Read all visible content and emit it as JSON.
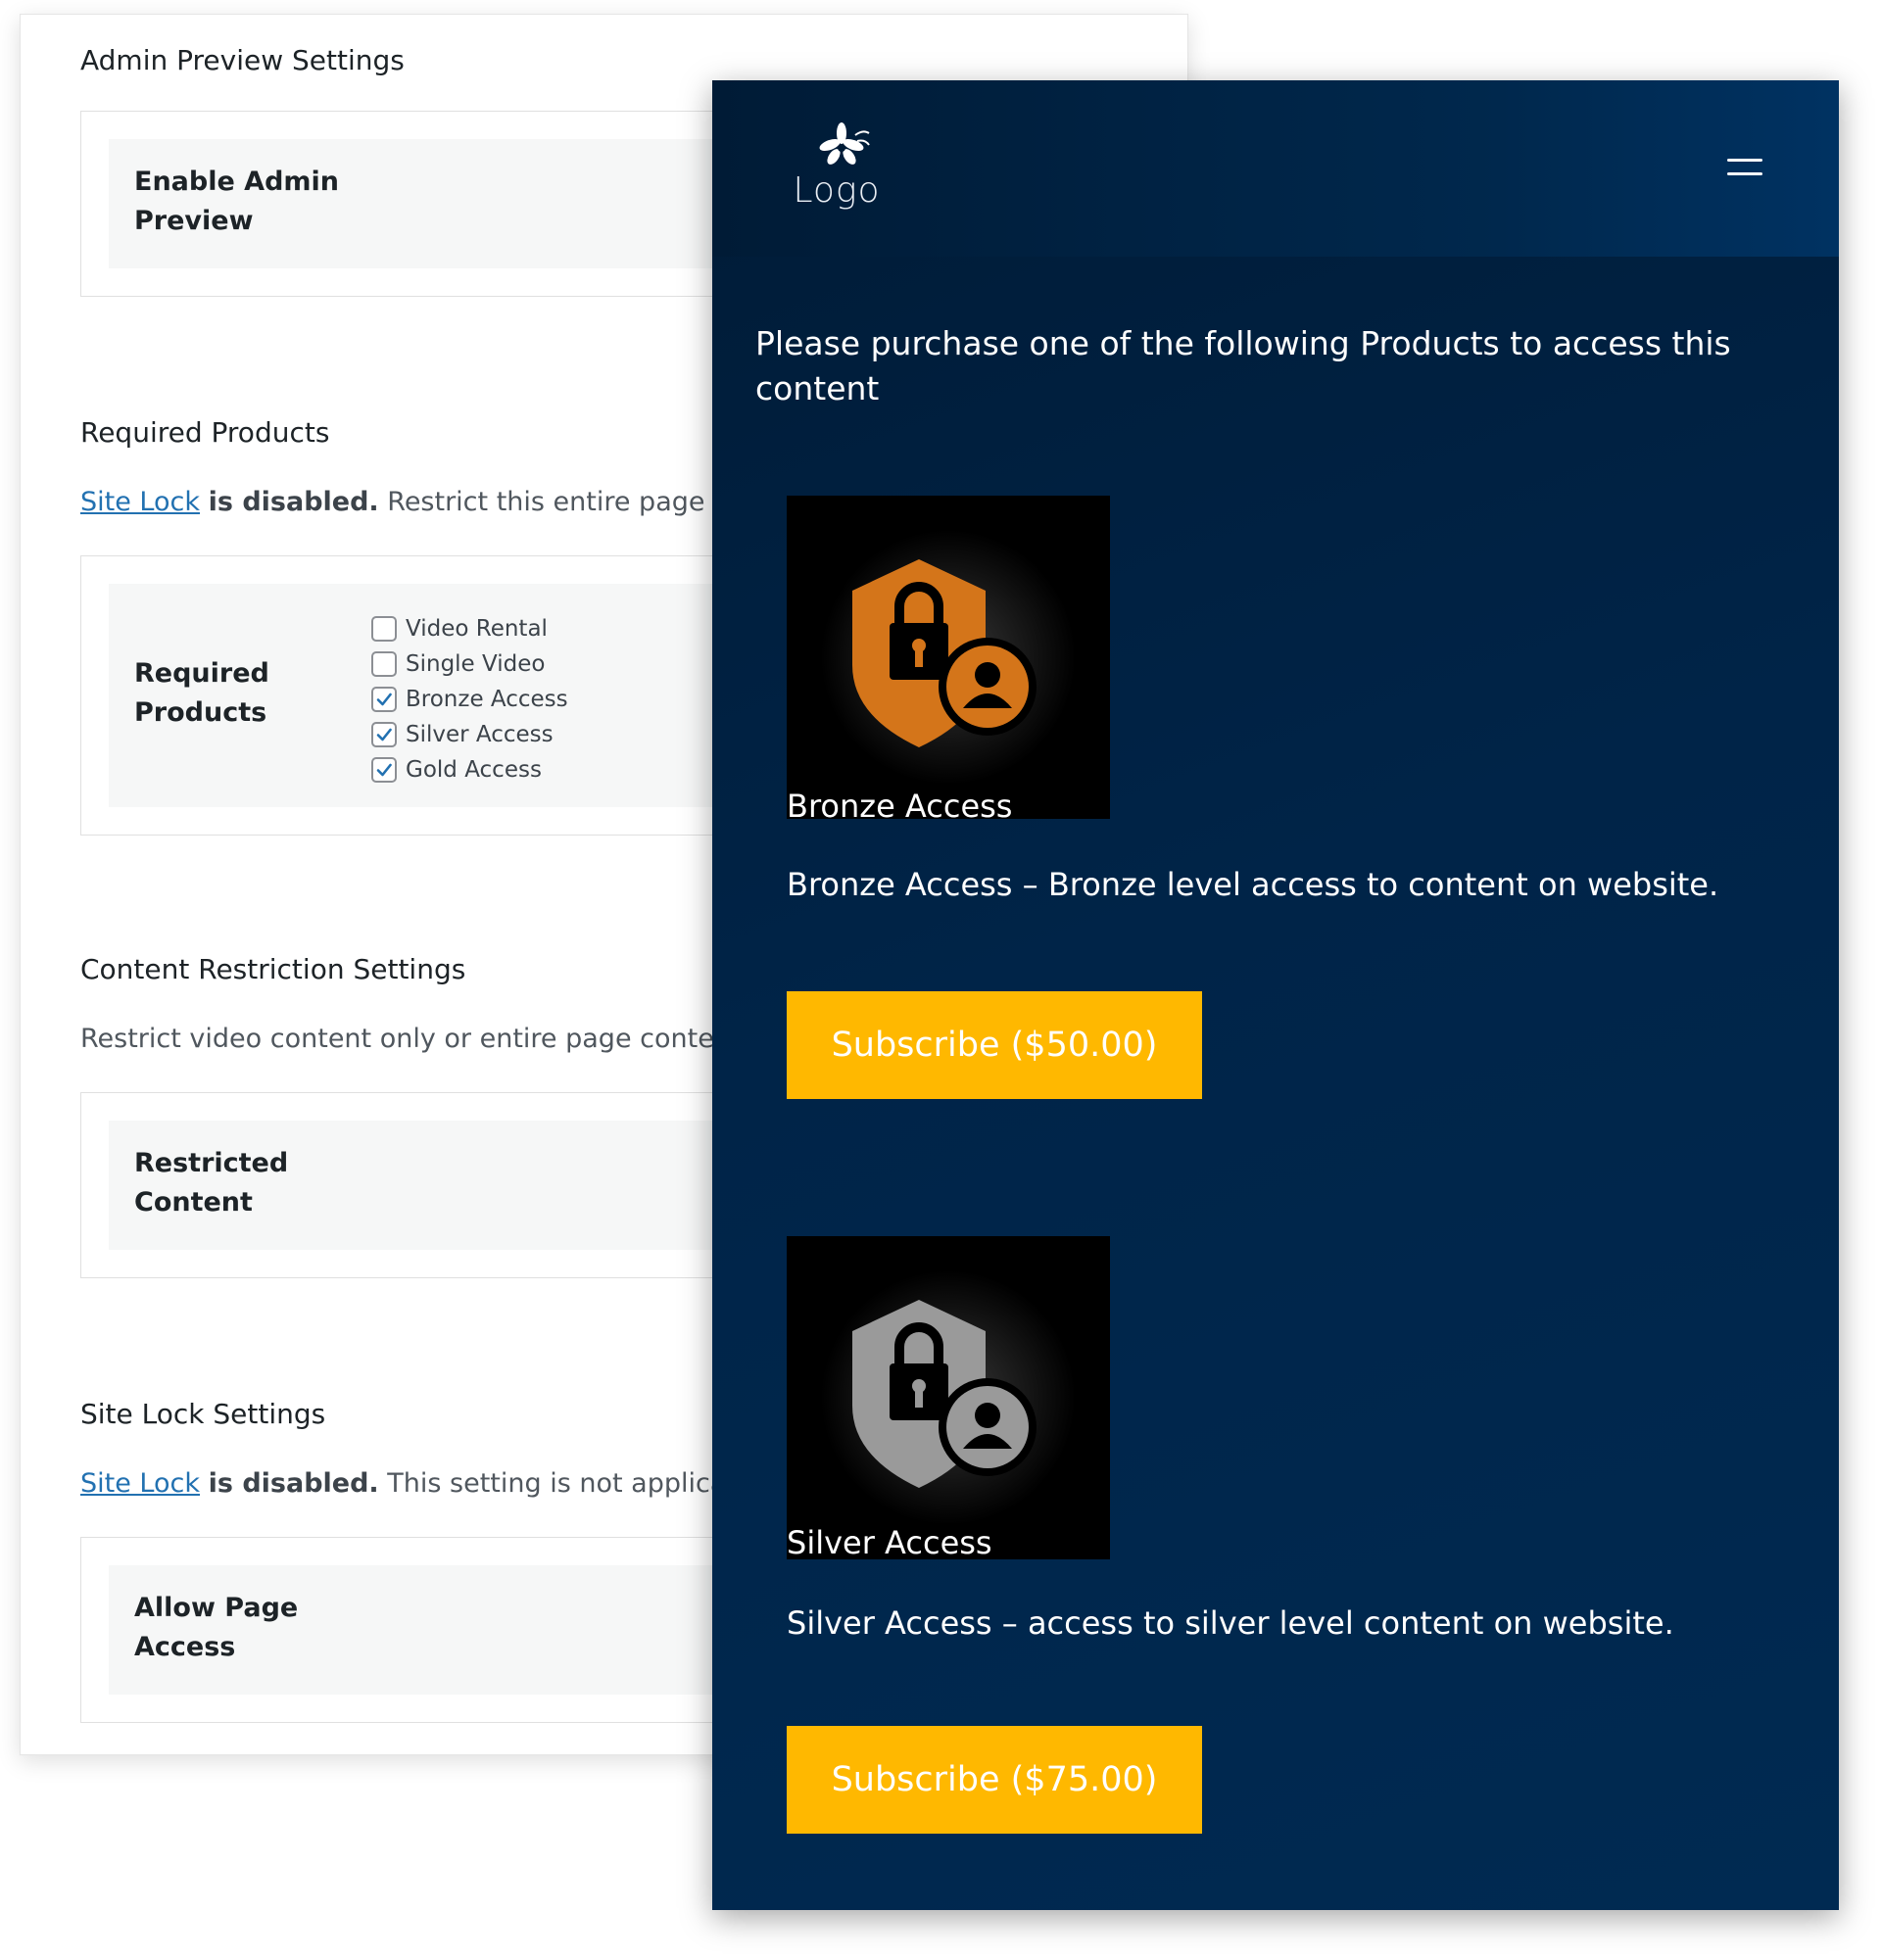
{
  "admin": {
    "preview_section": {
      "title": "Admin Preview Settings",
      "field_label": "Enable Admin Preview"
    },
    "required_section": {
      "title": "Required Products",
      "link": "Site Lock",
      "status": "is disabled.",
      "desc": "Restrict this entire page by se",
      "field_label": "Required Products",
      "products": [
        {
          "label": "Video Rental",
          "checked": false
        },
        {
          "label": "Single Video",
          "checked": false
        },
        {
          "label": "Bronze Access",
          "checked": true
        },
        {
          "label": "Silver Access",
          "checked": true
        },
        {
          "label": "Gold Access",
          "checked": true
        }
      ]
    },
    "restriction_section": {
      "title": "Content Restriction Settings",
      "desc": "Restrict video content only or entire page content. ",
      "field_label": "Restricted Content"
    },
    "sitelock_section": {
      "title": "Site Lock Settings",
      "link": "Site Lock",
      "status": "is disabled.",
      "desc": "This setting is not applicable.",
      "field_label": "Allow Page Access"
    }
  },
  "front": {
    "logo_text": "Logo",
    "message": "Please purchase one of the following Products to access this content",
    "products": [
      {
        "name": "Bronze Access",
        "description": "Bronze Access – Bronze level access to content on website.",
        "button": "Subscribe ($50.00)",
        "icon": "shield-lock-user-icon",
        "icon_color": "#d4751a"
      },
      {
        "name": "Silver Access",
        "description": "Silver Access – access to silver level content on website.",
        "button": "Subscribe ($75.00)",
        "icon": "shield-lock-user-icon",
        "icon_color": "#9a9a9a"
      }
    ]
  },
  "colors": {
    "link": "#2271b1",
    "button": "#ffb800",
    "panel_bg": "#002448",
    "checkbox_check": "#2271b1"
  }
}
